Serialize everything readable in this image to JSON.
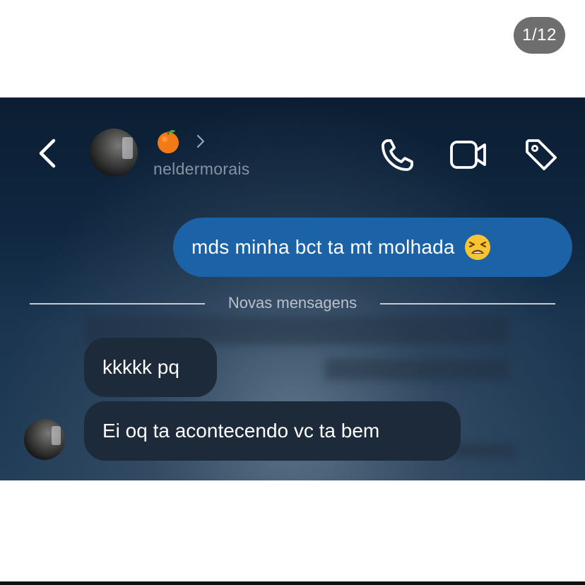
{
  "viewer": {
    "page_counter": "1/12"
  },
  "header": {
    "contact_emoji": "🍊",
    "username": "neldermorais",
    "icons": [
      "back-chevron-icon",
      "avatar",
      "chevron-right-icon",
      "phone-icon",
      "video-camera-icon",
      "tag-icon"
    ]
  },
  "messages": [
    {
      "direction": "sent",
      "text": "mds minha bct ta mt molhada",
      "emoji": "😫"
    },
    {
      "direction": "received",
      "text": "kkkkk pq"
    },
    {
      "direction": "received",
      "text": "Ei oq ta acontecendo vc ta bem"
    }
  ],
  "divider": {
    "label": "Novas mensagens"
  },
  "colors": {
    "sent_bubble": "#1b62a6",
    "received_bubble": "#1c2a3a",
    "counter_pill": "#6e6e6e",
    "chat_background": "#0f2740",
    "username_text": "#8393a3"
  }
}
